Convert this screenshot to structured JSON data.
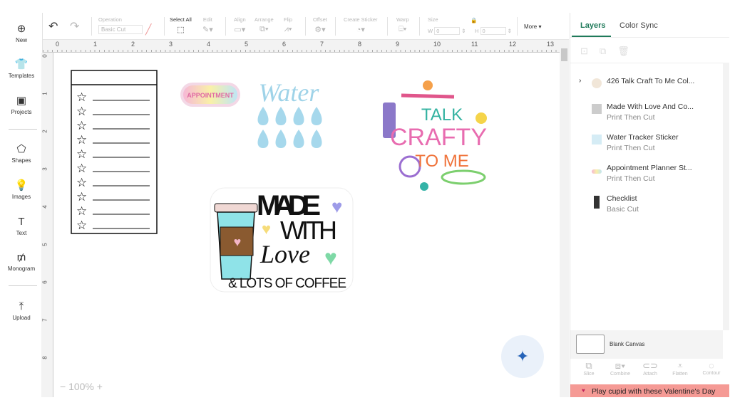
{
  "sidebar": {
    "items": [
      {
        "label": "New",
        "icon": "plus-circle-icon"
      },
      {
        "label": "Templates",
        "icon": "shirt-icon"
      },
      {
        "label": "Projects",
        "icon": "projects-icon"
      },
      {
        "label": "Shapes",
        "icon": "shapes-icon"
      },
      {
        "label": "Images",
        "icon": "lightbulb-icon"
      },
      {
        "label": "Text",
        "icon": "text-icon"
      },
      {
        "label": "Monogram",
        "icon": "monogram-icon"
      },
      {
        "label": "Upload",
        "icon": "upload-icon"
      }
    ]
  },
  "toolbar": {
    "undo": "↶",
    "redo": "↷",
    "operation_label": "Operation",
    "operation_value": "Basic Cut",
    "select_all": "Select All",
    "edit": "Edit",
    "align": "Align",
    "arrange": "Arrange",
    "flip": "Flip",
    "offset": "Offset",
    "create_sticker": "Create Sticker",
    "warp": "Warp",
    "size": "Size",
    "w_label": "W",
    "h_label": "H",
    "w_value": "0",
    "h_value": "0",
    "more": "More ▾"
  },
  "ruler": {
    "h": [
      "0",
      "1",
      "2",
      "3",
      "4",
      "5",
      "6",
      "7",
      "8",
      "9",
      "10",
      "11",
      "12",
      "13"
    ],
    "v": [
      "0",
      "1",
      "2",
      "3",
      "4",
      "5",
      "6",
      "7",
      "8"
    ]
  },
  "canvas": {
    "appointment_sticker": "APPOINTMENT",
    "water_sticker": "Water",
    "talk_crafty": [
      "TALK",
      "CRAFTY",
      "TO ME"
    ],
    "made_with_love": [
      "MADE",
      "WITH",
      "Love",
      "& LOTS OF COFFEE"
    ],
    "checklist_rows": 10
  },
  "zoom": {
    "value": "100%",
    "minus": "−",
    "plus": "+"
  },
  "panel": {
    "tabs": [
      "Layers",
      "Color Sync"
    ],
    "layers": [
      {
        "name": "426 Talk Craft To Me Col...",
        "sub": "",
        "expandable": true
      },
      {
        "name": "Made With Love And Co...",
        "sub": "Print Then Cut"
      },
      {
        "name": "Water Tracker Sticker",
        "sub": "Print Then Cut"
      },
      {
        "name": "Appointment Planner St...",
        "sub": "Print Then Cut"
      },
      {
        "name": "Checklist",
        "sub": "Basic Cut"
      }
    ],
    "blank_canvas": "Blank Canvas",
    "tools": [
      "Slice",
      "Combine",
      "Attach",
      "Flatten",
      "Contour"
    ],
    "promo": "Play cupid with these Valentine's Day"
  },
  "colors": {
    "accent": "#1f7a5a",
    "promo": "#f59a95",
    "fab": "#2563b8"
  }
}
